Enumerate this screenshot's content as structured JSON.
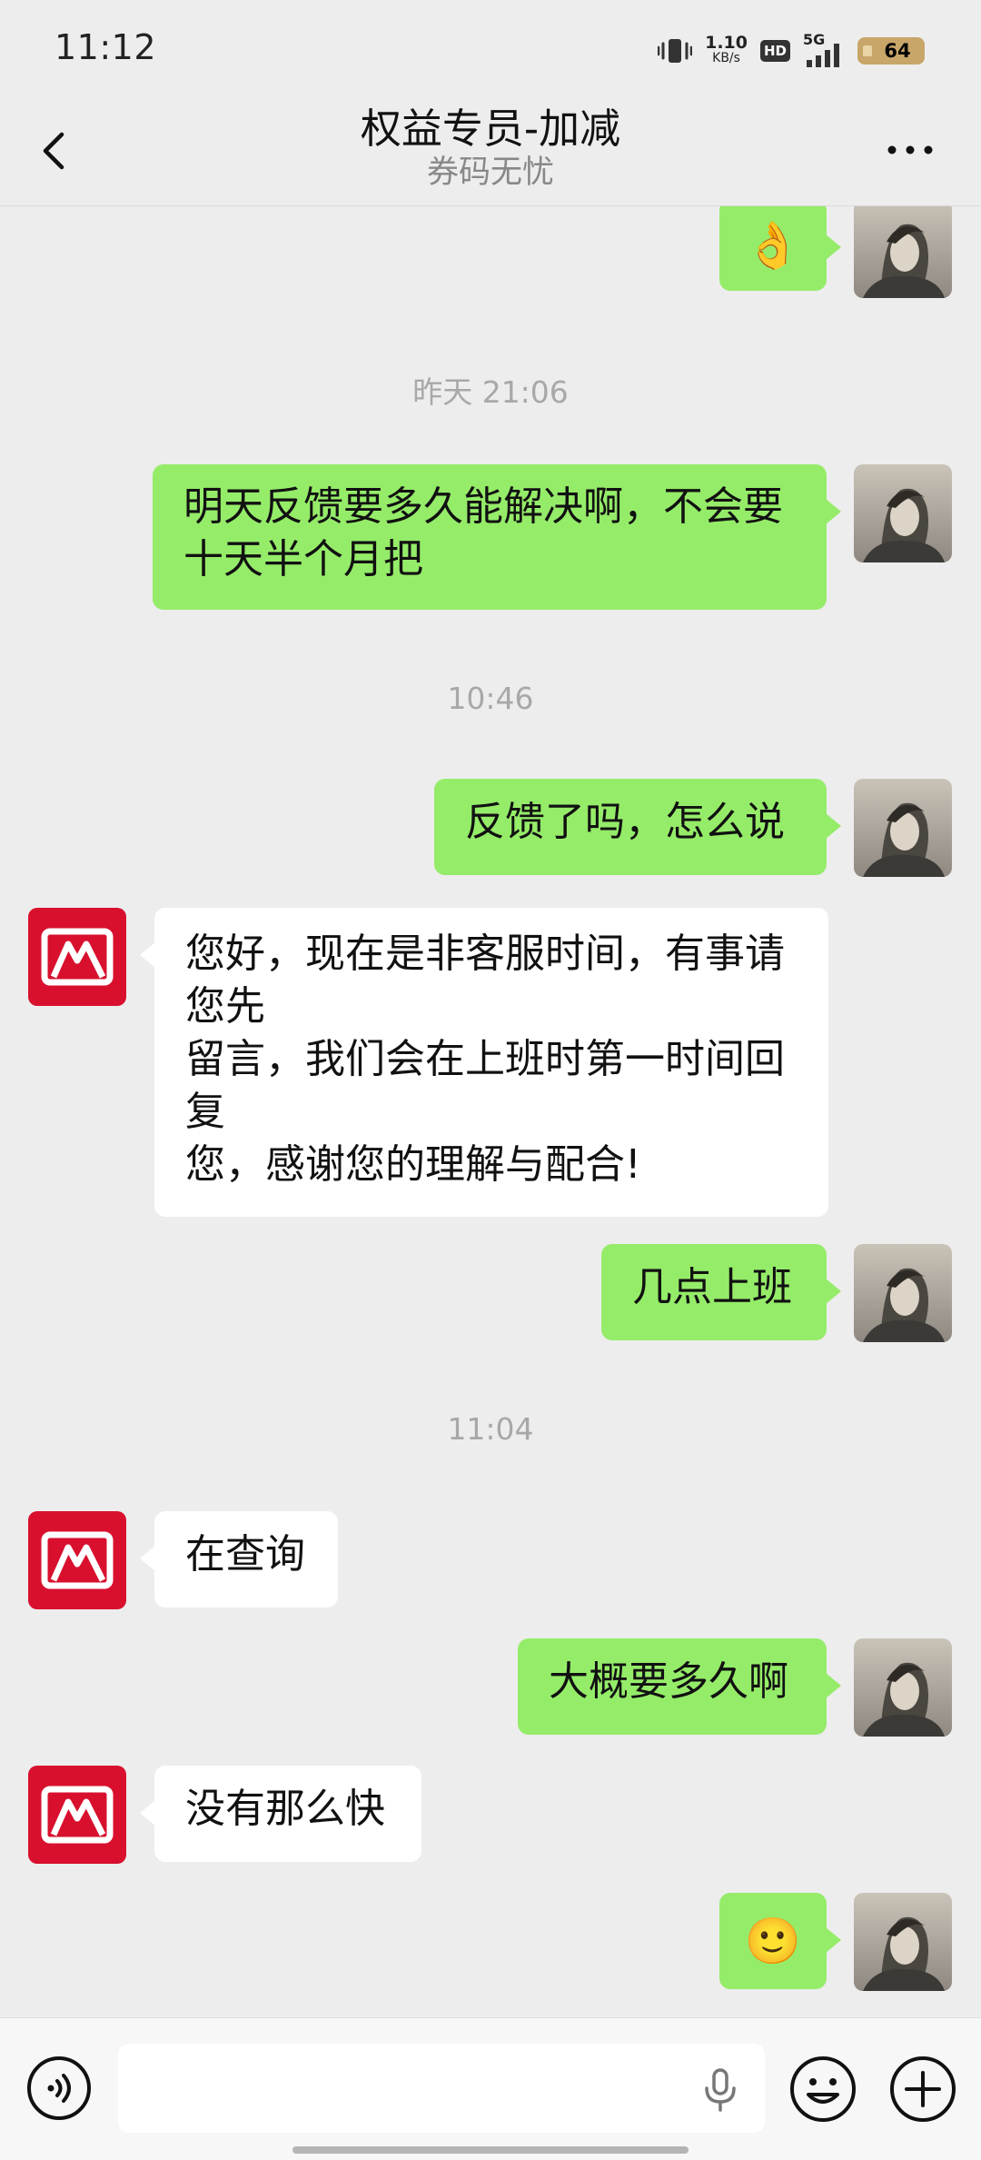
{
  "status_bar": {
    "time": "11:12",
    "net_speed_value": "1.10",
    "net_speed_unit": "KB/s",
    "hd_label": "HD",
    "network_label": "5G",
    "battery_level": "64",
    "icons": [
      "vibrate-icon",
      "signal-icon",
      "battery-icon"
    ]
  },
  "header": {
    "title": "权益专员-加减",
    "subtitle": "券码无忧",
    "icons": [
      "chevron-left-icon",
      "more-icon"
    ]
  },
  "messages": [
    {
      "type": "bubble",
      "direction": "out",
      "kind": "emoji",
      "emoji": "👌"
    },
    {
      "type": "timestamp",
      "text": "昨天 21:06"
    },
    {
      "type": "bubble",
      "direction": "out",
      "text": "明天反馈要多久能解决啊，不会要\n十天半个月把"
    },
    {
      "type": "timestamp",
      "text": "10:46"
    },
    {
      "type": "bubble",
      "direction": "out",
      "text": "反馈了吗，怎么说"
    },
    {
      "type": "bubble",
      "direction": "in",
      "text": "您好，现在是非客服时间，有事请\n您先\n留言，我们会在上班时第一时间回\n复\n您，感谢您的理解与配合!"
    },
    {
      "type": "bubble",
      "direction": "out",
      "text": "几点上班"
    },
    {
      "type": "timestamp",
      "text": "11:04"
    },
    {
      "type": "bubble",
      "direction": "in",
      "text": "在查询"
    },
    {
      "type": "bubble",
      "direction": "out",
      "text": "大概要多久啊"
    },
    {
      "type": "bubble",
      "direction": "in",
      "text": "没有那么快"
    },
    {
      "type": "bubble",
      "direction": "out",
      "kind": "emoji",
      "emoji": "🙂"
    }
  ],
  "input_bar": {
    "placeholder": "",
    "icons": [
      "voice-icon",
      "microphone-icon",
      "emoji-icon",
      "plus-icon"
    ]
  },
  "colors": {
    "background": "#ededed",
    "outgoing_bubble": "#95ec69",
    "incoming_bubble": "#ffffff",
    "agent_avatar": "#d8102e",
    "timestamp_text": "#a8a8a8"
  }
}
